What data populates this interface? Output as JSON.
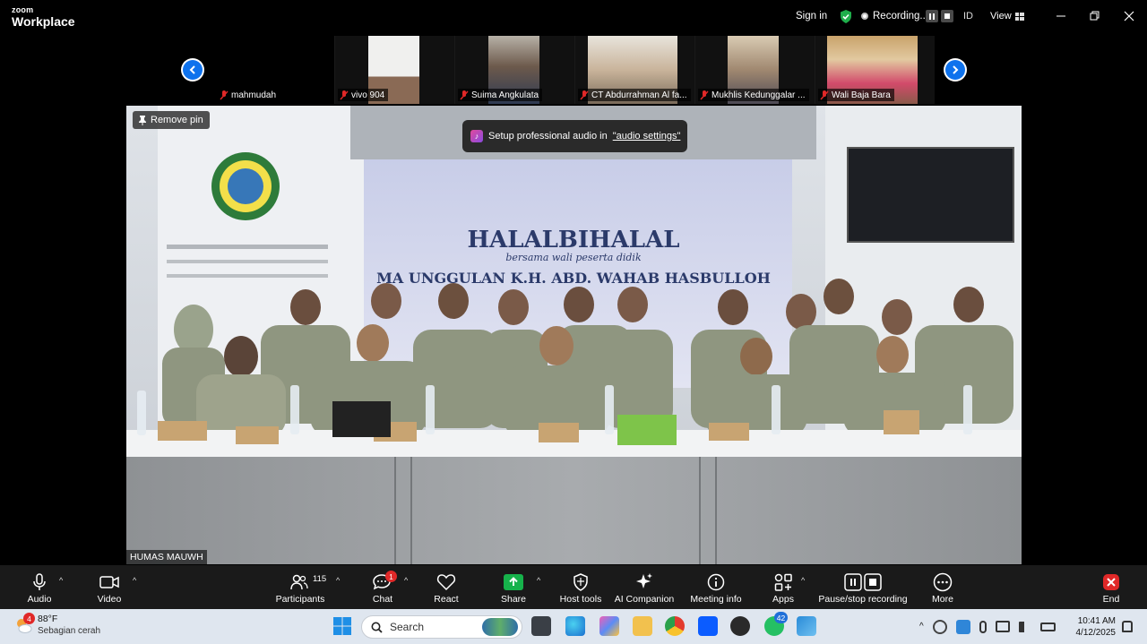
{
  "app": {
    "logo_line1": "zoom",
    "logo_line2": "Workplace"
  },
  "titlebar": {
    "sign_in": "Sign in",
    "recording": "Recording...",
    "id_label": "ID",
    "view_label": "View"
  },
  "participants_strip": [
    {
      "name": "mahmudah",
      "muted": true
    },
    {
      "name": "vivo    904",
      "muted": true
    },
    {
      "name": "Suima Angkulata",
      "muted": true
    },
    {
      "name": "CT Abdurrahman Al fa...",
      "muted": true
    },
    {
      "name": "Mukhlis Kedunggalar ...",
      "muted": true
    },
    {
      "name": "Wali Baja Bara",
      "muted": true
    }
  ],
  "main_video": {
    "pin_label": "Remove pin",
    "toast_text": "Setup professional audio in",
    "toast_link": "\"audio settings\"",
    "speaker_name": "HUMAS MAUWH",
    "banner_title": "HALALBIHALAL",
    "banner_sub": "bersama wali peserta didik",
    "banner_school": "MA UNGGULAN K.H. ABD. WAHAB HASBULLOH"
  },
  "toolbar": {
    "audio": "Audio",
    "video": "Video",
    "participants": "Participants",
    "participants_count": "115",
    "chat": "Chat",
    "chat_badge": "1",
    "react": "React",
    "share": "Share",
    "host_tools": "Host tools",
    "ai_companion": "AI Companion",
    "meeting_info": "Meeting info",
    "apps": "Apps",
    "pause_recording": "Pause/stop recording",
    "more": "More",
    "end": "End"
  },
  "taskbar": {
    "weather_badge": "4",
    "temperature": "88°F",
    "weather_desc": "Sebagian cerah",
    "search_placeholder": "Search",
    "whatsapp_badge": "42",
    "time": "10:41 AM",
    "date": "4/12/2025"
  },
  "colors": {
    "accent": "#0e72ed",
    "share_green": "#16b24b",
    "record_red": "#e02828"
  }
}
